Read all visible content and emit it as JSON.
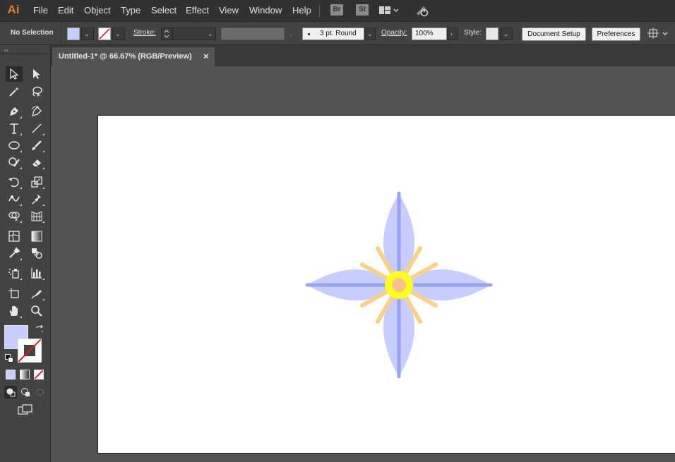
{
  "app": {
    "logo": "Ai"
  },
  "menu": {
    "items": [
      "File",
      "Edit",
      "Object",
      "Type",
      "Select",
      "Effect",
      "View",
      "Window",
      "Help"
    ],
    "bridge_label": "Br",
    "stock_label": "St"
  },
  "control": {
    "selection": "No Selection",
    "stroke_label": "Stroke:",
    "stroke_profile": "3 pt. Round",
    "opacity_label": "Opacity:",
    "opacity_value": "100%",
    "style_label": "Style:",
    "document_setup": "Document Setup",
    "preferences": "Preferences"
  },
  "document": {
    "tab_title": "Untitled-1* @ 66.67% (RGB/Preview)",
    "close": "×"
  },
  "colors": {
    "fill": "#c8cdff",
    "petal": "#c8cdff",
    "vein": "#9aa4f5",
    "stamen": "#f8d08a",
    "center_ring": "#fcfc20",
    "center_dot": "#f7c28d",
    "none_slash": "#e02020"
  },
  "icons": {
    "tools": [
      "selection-tool-icon",
      "direct-selection-tool-icon",
      "magic-wand-tool-icon",
      "lasso-tool-icon",
      "pen-tool-icon",
      "curvature-tool-icon",
      "type-tool-icon",
      "line-segment-tool-icon",
      "ellipse-tool-icon",
      "paintbrush-tool-icon",
      "shaper-tool-icon",
      "eraser-tool-icon",
      "rotate-tool-icon",
      "scale-tool-icon",
      "warp-tool-icon",
      "puppet-warp-tool-icon",
      "shape-builder-tool-icon",
      "perspective-grid-tool-icon",
      "mesh-tool-icon",
      "gradient-tool-icon",
      "eyedropper-tool-icon",
      "blend-tool-icon",
      "symbol-sprayer-tool-icon",
      "column-graph-tool-icon",
      "artboard-tool-icon",
      "slice-tool-icon",
      "hand-tool-icon",
      "zoom-tool-icon"
    ]
  }
}
